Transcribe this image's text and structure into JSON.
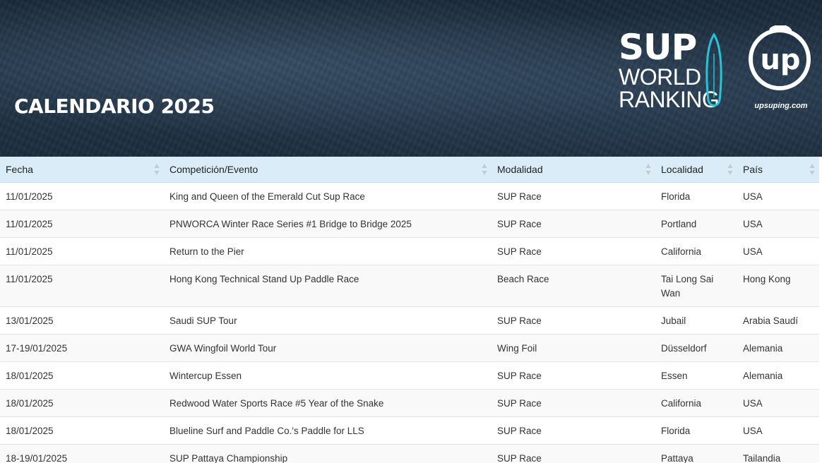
{
  "header": {
    "title": "CALENDARIO 2025",
    "logo_sup": [
      "SUP",
      "WORLD",
      "RANKING"
    ],
    "logo_up": "up",
    "site": "upsuping.com"
  },
  "columns": [
    "Fecha",
    "Competición/Evento",
    "Modalidad",
    "Localidad",
    "País"
  ],
  "rows": [
    {
      "fecha": "11/01/2025",
      "evento": "King and Queen of the Emerald Cut Sup Race",
      "modalidad": "SUP Race",
      "localidad": "Florida",
      "pais": "USA"
    },
    {
      "fecha": "11/01/2025",
      "evento": "PNWORCA Winter Race Series #1 Bridge to Bridge 2025",
      "modalidad": "SUP Race",
      "localidad": "Portland",
      "pais": "USA"
    },
    {
      "fecha": "11/01/2025",
      "evento": "Return to the Pier",
      "modalidad": "SUP Race",
      "localidad": "California",
      "pais": "USA"
    },
    {
      "fecha": "11/01/2025",
      "evento": "Hong Kong Technical Stand Up Paddle Race",
      "modalidad": "Beach Race",
      "localidad": "Tai Long Sai Wan",
      "pais": "Hong Kong"
    },
    {
      "fecha": "13/01/2025",
      "evento": "Saudi SUP Tour",
      "modalidad": "SUP Race",
      "localidad": "Jubail",
      "pais": "Arabia Saudí"
    },
    {
      "fecha": "17-19/01/2025",
      "evento": "GWA Wingfoil World Tour",
      "modalidad": "Wing Foil",
      "localidad": "Düsseldorf",
      "pais": "Alemania"
    },
    {
      "fecha": "18/01/2025",
      "evento": "Wintercup Essen",
      "modalidad": "SUP Race",
      "localidad": "Essen",
      "pais": "Alemania"
    },
    {
      "fecha": "18/01/2025",
      "evento": "Redwood Water Sports Race #5 Year of the Snake",
      "modalidad": "SUP Race",
      "localidad": "California",
      "pais": "USA"
    },
    {
      "fecha": "18/01/2025",
      "evento": "Blueline Surf and Paddle Co.'s Paddle for LLS",
      "modalidad": "SUP Race",
      "localidad": "Florida",
      "pais": "USA"
    },
    {
      "fecha": "18-19/01/2025",
      "evento": "SUP Pattaya Championship",
      "modalidad": "SUP Race",
      "localidad": "Pattaya",
      "pais": "Tailandia"
    },
    {
      "fecha": "",
      "evento": "",
      "modalidad": "",
      "localidad": "",
      "pais": ""
    }
  ],
  "colors": {
    "header_row": "#d9ecf7",
    "banner": "#1f3042",
    "accent": "#27c4d6"
  }
}
